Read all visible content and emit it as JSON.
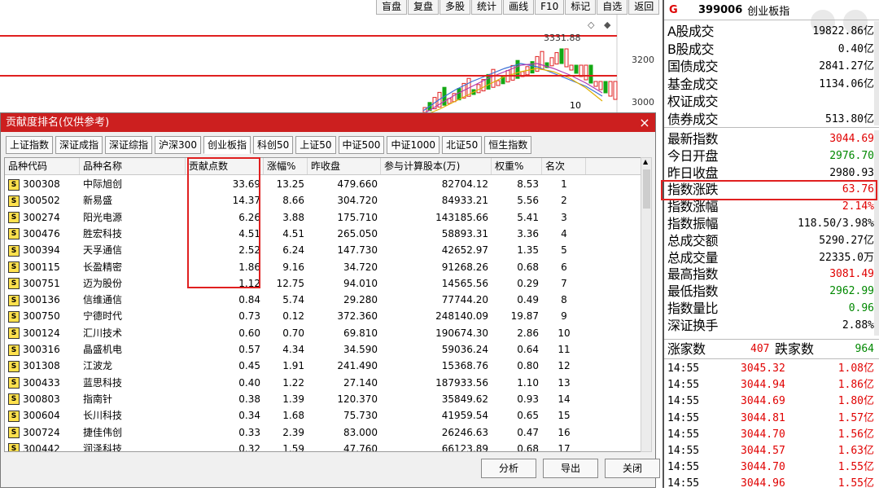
{
  "toolbar": [
    "盲盘",
    "复盘",
    "多股",
    "统计",
    "画线",
    "F10",
    "标记",
    "自选",
    "返回"
  ],
  "chart": {
    "peak_label": "3331.88",
    "axis": [
      "3200",
      "3000"
    ],
    "marker": "10"
  },
  "right_panel": {
    "header": {
      "flag": "G",
      "code": "399006",
      "name": "创业板指"
    },
    "stats": [
      {
        "label": "A股成交",
        "value": "19822.86亿",
        "color": "#000000"
      },
      {
        "label": "B股成交",
        "value": "0.40亿",
        "color": "#000000"
      },
      {
        "label": "国债成交",
        "value": "2841.27亿",
        "color": "#000000"
      },
      {
        "label": "基金成交",
        "value": "1134.06亿",
        "color": "#000000"
      },
      {
        "label": "权证成交",
        "value": "",
        "color": "#000000"
      },
      {
        "label": "债券成交",
        "value": "513.80亿",
        "color": "#000000"
      }
    ],
    "quotes": [
      {
        "label": "最新指数",
        "value": "3044.69",
        "color": "#e00000"
      },
      {
        "label": "今日开盘",
        "value": "2976.70",
        "color": "#008800"
      },
      {
        "label": "昨日收盘",
        "value": "2980.93",
        "color": "#000000"
      },
      {
        "label": "指数涨跌",
        "value": "63.76",
        "color": "#e00000"
      },
      {
        "label": "指数涨幅",
        "value": "2.14%",
        "color": "#e00000"
      },
      {
        "label": "指数振幅",
        "value": "118.50/3.98%",
        "color": "#000000"
      },
      {
        "label": "总成交额",
        "value": "5290.27亿",
        "color": "#000000"
      },
      {
        "label": "总成交量",
        "value": "22335.0万",
        "color": "#000000"
      },
      {
        "label": "最高指数",
        "value": "3081.49",
        "color": "#e00000"
      },
      {
        "label": "最低指数",
        "value": "2962.99",
        "color": "#008800"
      },
      {
        "label": "指数量比",
        "value": "0.96",
        "color": "#008800"
      },
      {
        "label": "深证换手",
        "value": "2.88%",
        "color": "#000000"
      }
    ],
    "updown": {
      "up_label": "涨家数",
      "up": "407",
      "down_label": "跌家数",
      "down": "964"
    },
    "ticks": [
      {
        "time": "14:55",
        "price": "3045.32",
        "amount": "1.08亿"
      },
      {
        "time": "14:55",
        "price": "3044.94",
        "amount": "1.86亿"
      },
      {
        "time": "14:55",
        "price": "3044.69",
        "amount": "1.80亿"
      },
      {
        "time": "14:55",
        "price": "3044.81",
        "amount": "1.57亿"
      },
      {
        "time": "14:55",
        "price": "3044.70",
        "amount": "1.56亿"
      },
      {
        "time": "14:55",
        "price": "3044.57",
        "amount": "1.63亿"
      },
      {
        "time": "14:55",
        "price": "3044.70",
        "amount": "1.55亿"
      },
      {
        "time": "14:55",
        "price": "3044.96",
        "amount": "1.55亿"
      }
    ]
  },
  "dialog": {
    "title": "贡献度排名(仅供参考)",
    "close": "×",
    "tabs": [
      "上证指数",
      "深证成指",
      "深证综指",
      "沪深300",
      "创业板指",
      "科创50",
      "上证50",
      "中证500",
      "中证1000",
      "北证50",
      "恒生指数"
    ],
    "active_tab": 4,
    "columns": [
      "品种代码",
      "品种名称",
      "贡献点数",
      "涨幅%",
      "昨收盘",
      "参与计算股本(万)",
      "权重%",
      "名次"
    ],
    "rows": [
      [
        "300308",
        "中际旭创",
        "33.69",
        "13.25",
        "479.660",
        "82704.12",
        "8.53",
        "1"
      ],
      [
        "300502",
        "新易盛",
        "14.37",
        "8.66",
        "304.720",
        "84933.21",
        "5.56",
        "2"
      ],
      [
        "300274",
        "阳光电源",
        "6.26",
        "3.88",
        "175.710",
        "143185.66",
        "5.41",
        "3"
      ],
      [
        "300476",
        "胜宏科技",
        "4.51",
        "4.51",
        "265.050",
        "58893.31",
        "3.36",
        "4"
      ],
      [
        "300394",
        "天孚通信",
        "2.52",
        "6.24",
        "147.730",
        "42652.97",
        "1.35",
        "5"
      ],
      [
        "300115",
        "长盈精密",
        "1.86",
        "9.16",
        "34.720",
        "91268.26",
        "0.68",
        "6"
      ],
      [
        "300751",
        "迈为股份",
        "1.12",
        "12.75",
        "94.010",
        "14565.56",
        "0.29",
        "7"
      ],
      [
        "300136",
        "信维通信",
        "0.84",
        "5.74",
        "29.280",
        "77744.20",
        "0.49",
        "8"
      ],
      [
        "300750",
        "宁德时代",
        "0.73",
        "0.12",
        "372.360",
        "248140.09",
        "19.87",
        "9"
      ],
      [
        "300124",
        "汇川技术",
        "0.60",
        "0.70",
        "69.810",
        "190674.30",
        "2.86",
        "10"
      ],
      [
        "300316",
        "晶盛机电",
        "0.57",
        "4.34",
        "34.590",
        "59036.24",
        "0.64",
        "11"
      ],
      [
        "301308",
        "江波龙",
        "0.45",
        "1.91",
        "241.490",
        "15368.76",
        "0.80",
        "12"
      ],
      [
        "300433",
        "蓝思科技",
        "0.40",
        "1.22",
        "27.140",
        "187933.56",
        "1.10",
        "13"
      ],
      [
        "300803",
        "指南针",
        "0.38",
        "1.39",
        "120.370",
        "35849.62",
        "0.93",
        "14"
      ],
      [
        "300604",
        "长川科技",
        "0.34",
        "1.68",
        "75.730",
        "41959.54",
        "0.65",
        "15"
      ],
      [
        "300724",
        "捷佳伟创",
        "0.33",
        "2.39",
        "83.000",
        "26246.63",
        "0.47",
        "16"
      ],
      [
        "300442",
        "润泽科技",
        "0.32",
        "1.59",
        "47.760",
        "66123.89",
        "0.68",
        "17"
      ]
    ],
    "buttons": [
      "分析",
      "导出",
      "关闭"
    ]
  }
}
